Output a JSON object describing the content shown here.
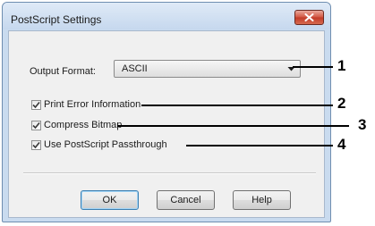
{
  "window": {
    "title": "PostScript Settings"
  },
  "form": {
    "output_format_label": "Output Format:",
    "output_format_value": "ASCII",
    "checkboxes": [
      {
        "label": "Print Error Information",
        "checked": true
      },
      {
        "label": "Compress Bitmap",
        "checked": true
      },
      {
        "label": "Use PostScript Passthrough",
        "checked": true
      }
    ]
  },
  "buttons": {
    "ok": "OK",
    "cancel": "Cancel",
    "help": "Help"
  },
  "callouts": [
    "1",
    "2",
    "3",
    "4"
  ],
  "colors": {
    "close_button": "#c94a35",
    "default_button_border": "#3c7fb1",
    "callout": "#000000"
  }
}
